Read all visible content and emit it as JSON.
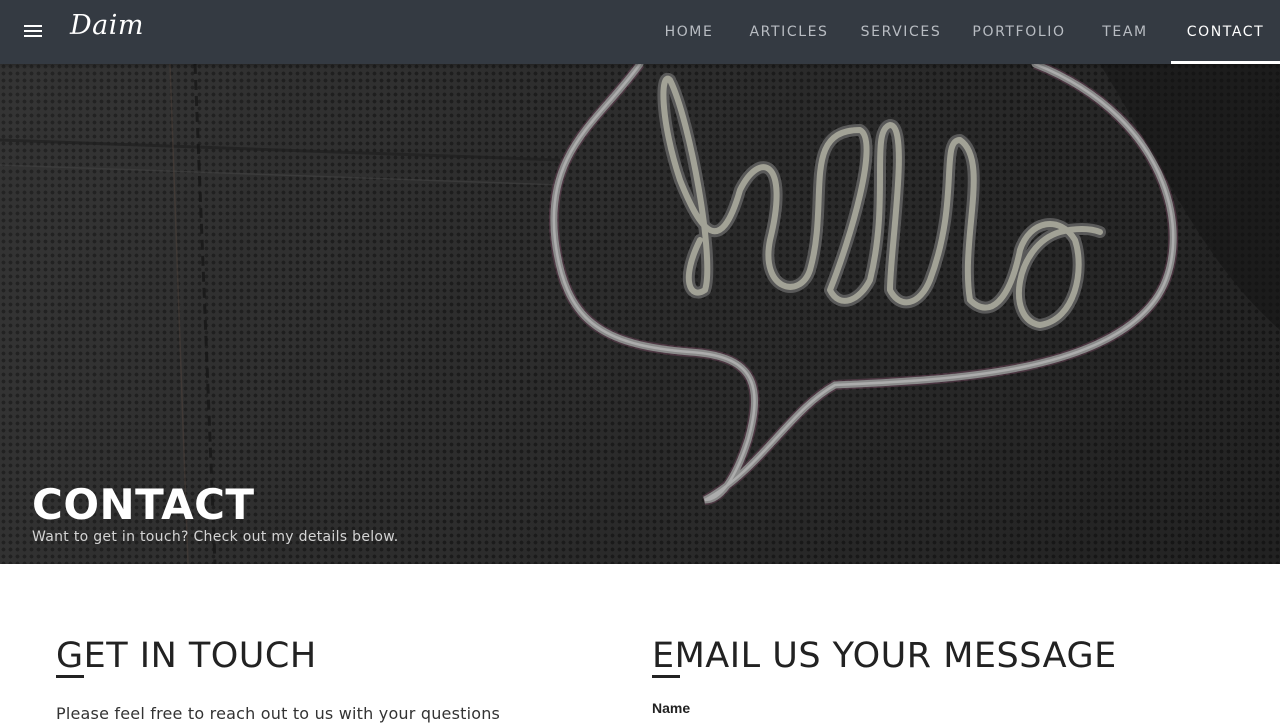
{
  "brand": {
    "logo": "Daim"
  },
  "nav": {
    "menu_icon": "hamburger-menu-icon",
    "items": [
      {
        "label": "HOME"
      },
      {
        "label": "ARTICLES"
      },
      {
        "label": "SERVICES"
      },
      {
        "label": "PORTFOLIO"
      },
      {
        "label": "TEAM"
      },
      {
        "label": "CONTACT",
        "active": true
      }
    ]
  },
  "hero": {
    "title": "CONTACT",
    "subtitle": "Want to get in touch? Check out my details below."
  },
  "get_in_touch": {
    "heading": "GET IN TOUCH",
    "text": "Please feel free to reach out to us with your questions"
  },
  "email_form": {
    "heading": "EMAIL US YOUR MESSAGE",
    "name_label": "Name"
  },
  "colors": {
    "navbar": "#343a42",
    "nav_text": "#b8bcc2",
    "nav_active": "#ffffff",
    "heading_text": "#222222",
    "neon_pink": "#c0709a"
  }
}
